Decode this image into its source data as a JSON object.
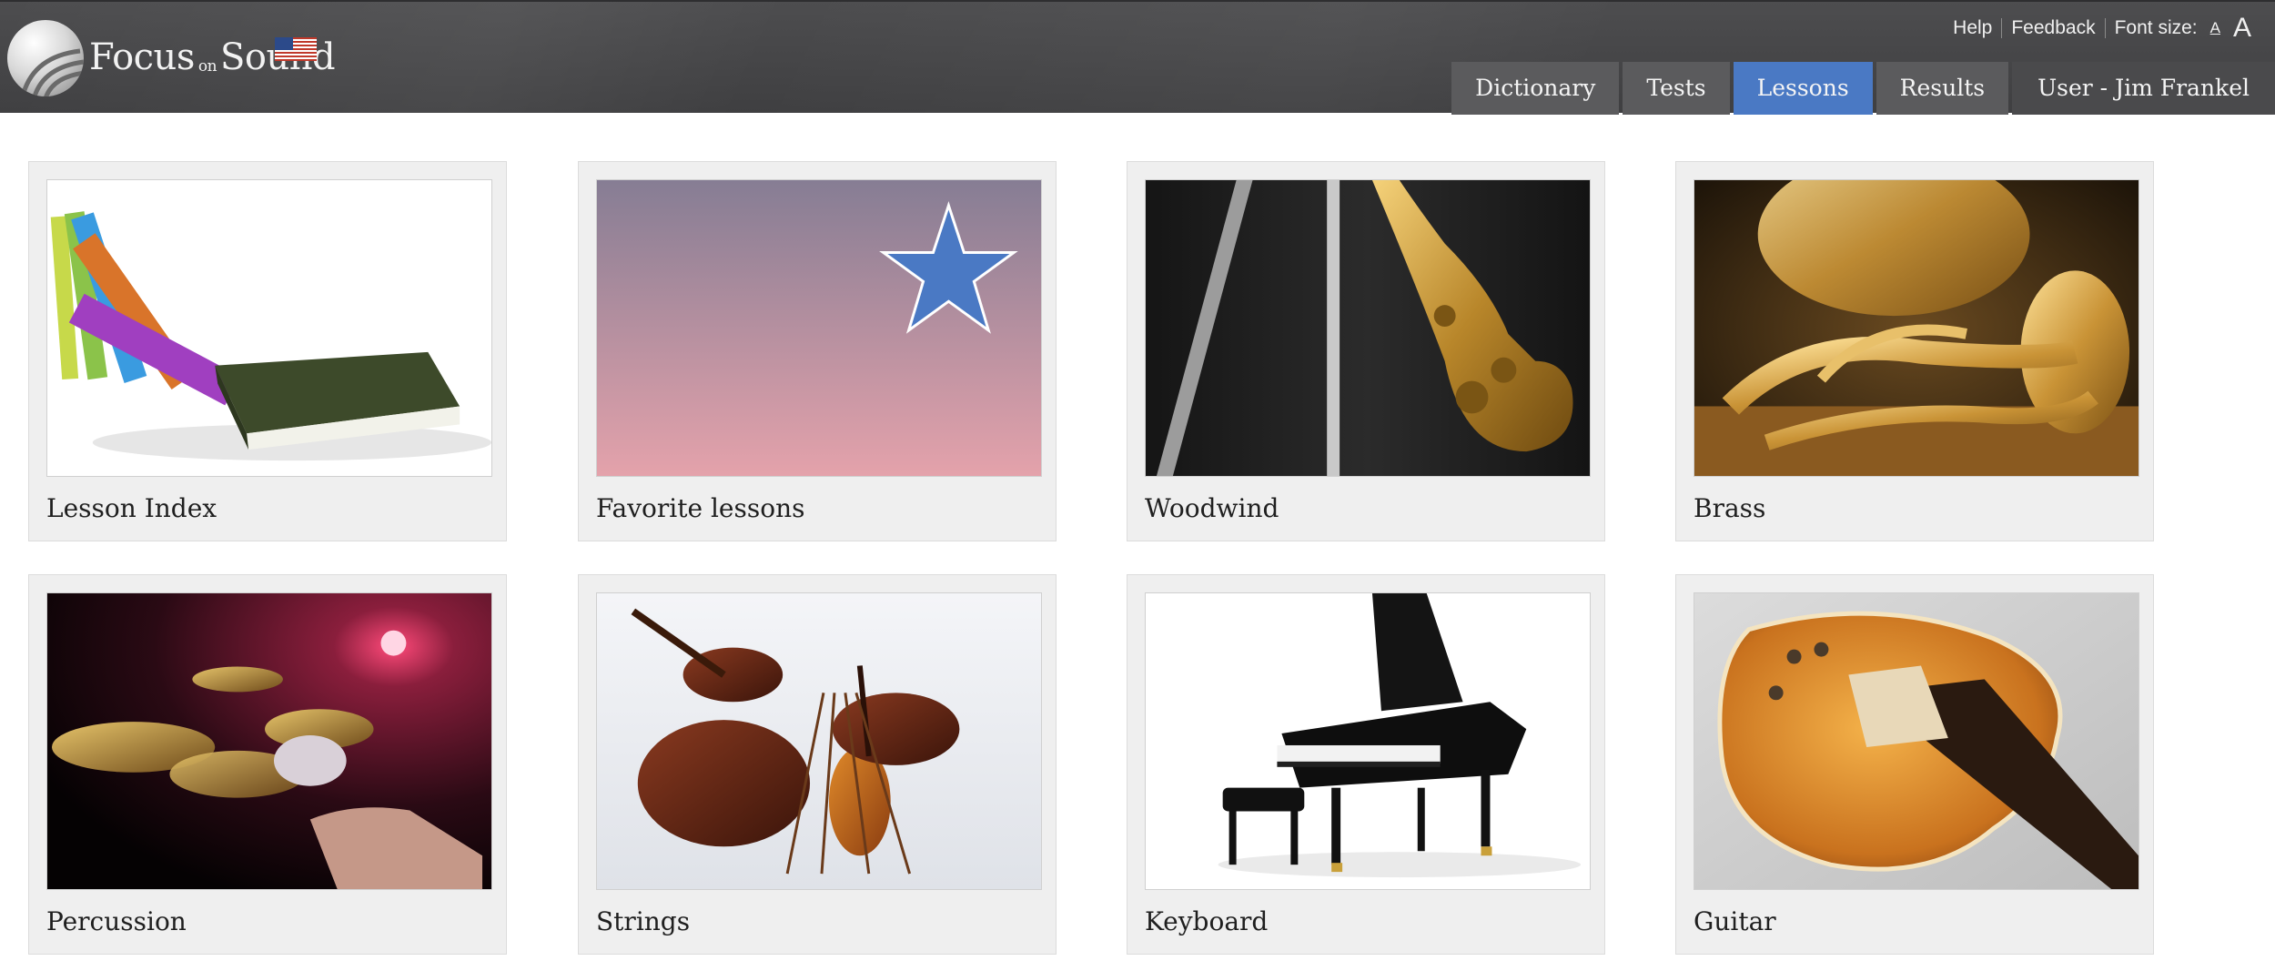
{
  "brand": {
    "name_part1": "Focus",
    "name_on": "on",
    "name_part2": "Sound"
  },
  "top_links": {
    "help": "Help",
    "feedback": "Feedback",
    "font_size_label": "Font size:",
    "font_small": "A",
    "font_large": "A"
  },
  "nav": {
    "tabs": [
      {
        "label": "Dictionary",
        "active": false
      },
      {
        "label": "Tests",
        "active": false
      },
      {
        "label": "Lessons",
        "active": true
      },
      {
        "label": "Results",
        "active": false
      },
      {
        "label": "User - Jim Frankel",
        "active": false
      }
    ]
  },
  "lessons": [
    {
      "label": "Lesson Index",
      "icon": "books-image"
    },
    {
      "label": "Favorite lessons",
      "icon": "star-image"
    },
    {
      "label": "Woodwind",
      "icon": "woodwind-image"
    },
    {
      "label": "Brass",
      "icon": "brass-image"
    },
    {
      "label": "Percussion",
      "icon": "percussion-image"
    },
    {
      "label": "Strings",
      "icon": "strings-image"
    },
    {
      "label": "Keyboard",
      "icon": "keyboard-image"
    },
    {
      "label": "Guitar",
      "icon": "guitar-image"
    }
  ],
  "colors": {
    "header_bg": "#434345",
    "active_tab": "#4a79c4",
    "tab_bg": "#5b5b5d",
    "card_bg": "#efefef",
    "star": "#4a79c4"
  }
}
